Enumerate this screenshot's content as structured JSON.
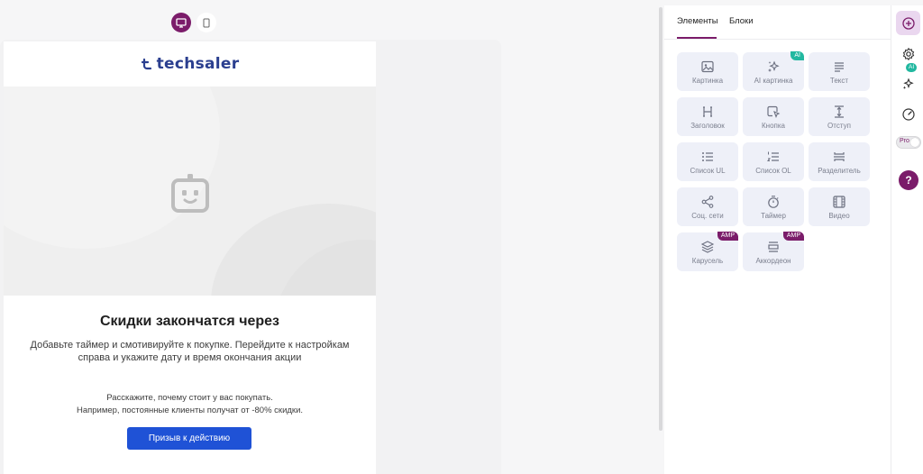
{
  "device_toggle": {
    "desktop": "desktop-icon",
    "mobile": "mobile-icon"
  },
  "email": {
    "logo_text": "techsaler",
    "title": "Скидки закончатся через",
    "description": "Добавьте таймер и смотивируйте к покупке. Перейдите к настройкам справа и укажите дату и время окончания акции",
    "note_line1": "Расскажите, почему стоит у вас покупать.",
    "note_line2": "Например, постоянные клиенты получат от -80% скидки.",
    "cta_label": "Призыв к действию"
  },
  "panel": {
    "tabs": [
      "Элементы",
      "Блоки"
    ],
    "active_tab": "Элементы",
    "tiles": [
      {
        "label": "Картинка",
        "icon": "image-icon"
      },
      {
        "label": "AI картинка",
        "icon": "sparkle-icon",
        "badge": "AI"
      },
      {
        "label": "Текст",
        "icon": "text-icon"
      },
      {
        "label": "Заголовок",
        "icon": "heading-icon"
      },
      {
        "label": "Кнопка",
        "icon": "button-icon"
      },
      {
        "label": "Отступ",
        "icon": "spacer-icon"
      },
      {
        "label": "Список UL",
        "icon": "list-ul-icon"
      },
      {
        "label": "Список OL",
        "icon": "list-ol-icon"
      },
      {
        "label": "Разделитель",
        "icon": "divider-icon"
      },
      {
        "label": "Соц. сети",
        "icon": "share-icon"
      },
      {
        "label": "Таймер",
        "icon": "timer-icon"
      },
      {
        "label": "Видео",
        "icon": "video-icon"
      },
      {
        "label": "Карусель",
        "icon": "layers-icon",
        "badge": "AMP"
      },
      {
        "label": "Аккордеон",
        "icon": "accordion-icon",
        "badge": "AMP"
      }
    ]
  },
  "sidebar": {
    "ai_label": "AI",
    "pro_label": "Pro",
    "help_label": "?"
  },
  "colors": {
    "accent": "#7b1c6a",
    "cta": "#1f52d6",
    "ai_badge": "#22b8a0",
    "tile_bg": "#eef0f8"
  }
}
